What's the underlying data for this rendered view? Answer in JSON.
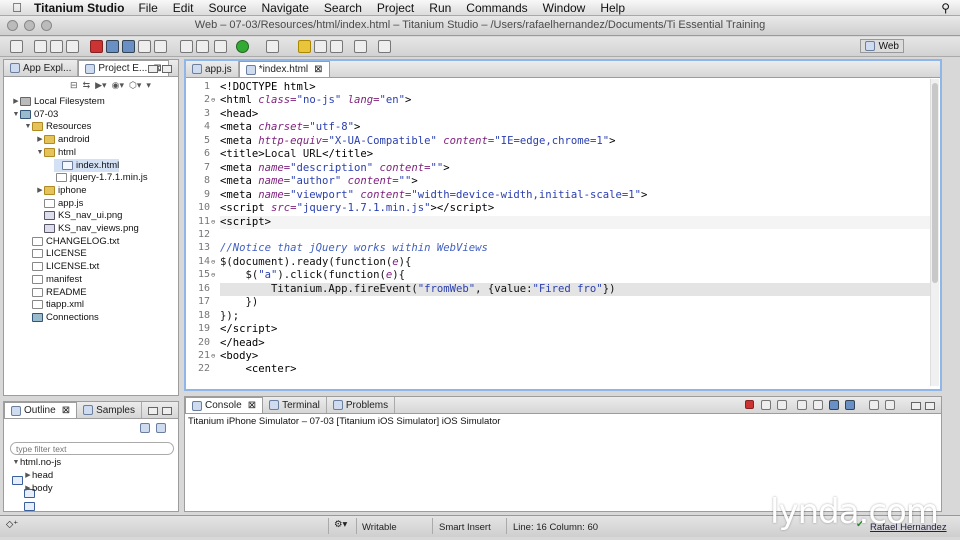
{
  "menubar": {
    "app": "Titanium Studio",
    "items": [
      "File",
      "Edit",
      "Source",
      "Navigate",
      "Search",
      "Project",
      "Run",
      "Commands",
      "Window",
      "Help"
    ]
  },
  "window_title": "Web – 07-03/Resources/html/index.html – Titanium Studio – /Users/rafaelhernandez/Documents/Ti Essential Training",
  "perspective": "Web",
  "explorer": {
    "tabs": [
      {
        "label": "App Expl..."
      },
      {
        "label": "Project E..."
      }
    ],
    "tree": [
      {
        "label": "Local Filesystem",
        "icon": "drive"
      },
      {
        "label": "07-03",
        "icon": "proj"
      },
      {
        "label": "Resources",
        "icon": "folder"
      },
      {
        "label": "android",
        "icon": "folder"
      },
      {
        "label": "html",
        "icon": "folder"
      },
      {
        "label": "index.html",
        "icon": "html"
      },
      {
        "label": "jquery-1.7.1.min.js",
        "icon": "file"
      },
      {
        "label": "iphone",
        "icon": "folder"
      },
      {
        "label": "app.js",
        "icon": "file"
      },
      {
        "label": "KS_nav_ui.png",
        "icon": "img"
      },
      {
        "label": "KS_nav_views.png",
        "icon": "img"
      },
      {
        "label": "CHANGELOG.txt",
        "icon": "file"
      },
      {
        "label": "LICENSE",
        "icon": "file"
      },
      {
        "label": "LICENSE.txt",
        "icon": "file"
      },
      {
        "label": "manifest",
        "icon": "file"
      },
      {
        "label": "README",
        "icon": "file"
      },
      {
        "label": "tiapp.xml",
        "icon": "file"
      },
      {
        "label": "Connections",
        "icon": "proj"
      }
    ]
  },
  "editor": {
    "tabs": [
      {
        "label": "app.js"
      },
      {
        "label": "*index.html"
      }
    ],
    "lines": [
      {
        "n": "1",
        "html": "<span class=\"tg\">&lt;!DOCTYPE html&gt;</span>"
      },
      {
        "n": "2",
        "html": "<span class=\"tg\">&lt;html</span> <span class=\"at\">class=</span><span class=\"st\">\"no-js\"</span> <span class=\"at\">lang=</span><span class=\"st\">\"en\"</span><span class=\"tg\">&gt;</span>"
      },
      {
        "n": "3",
        "html": "<span class=\"tg\">&lt;head&gt;</span>"
      },
      {
        "n": "4",
        "html": "<span class=\"tg\">&lt;meta</span> <span class=\"at\">charset=</span><span class=\"st\">\"utf-8\"</span><span class=\"tg\">&gt;</span>"
      },
      {
        "n": "5",
        "html": "<span class=\"tg\">&lt;meta</span> <span class=\"at\">http-equiv=</span><span class=\"st\">\"X-UA-Compatible\"</span> <span class=\"at\">content=</span><span class=\"st\">\"IE=edge,chrome=1\"</span><span class=\"tg\">&gt;</span>"
      },
      {
        "n": "6",
        "html": "<span class=\"tg\">&lt;title&gt;</span>Local URL<span class=\"tg\">&lt;/title&gt;</span>"
      },
      {
        "n": "7",
        "html": "<span class=\"tg\">&lt;meta</span> <span class=\"at\">name=</span><span class=\"st\">\"description\"</span> <span class=\"at\">content=</span><span class=\"st\">\"\"</span><span class=\"tg\">&gt;</span>"
      },
      {
        "n": "8",
        "html": "<span class=\"tg\">&lt;meta</span> <span class=\"at\">name=</span><span class=\"st\">\"author\"</span> <span class=\"at\">content=</span><span class=\"st\">\"\"</span><span class=\"tg\">&gt;</span>"
      },
      {
        "n": "9",
        "html": "<span class=\"tg\">&lt;meta</span> <span class=\"at\">name=</span><span class=\"st\">\"viewport\"</span> <span class=\"at\">content=</span><span class=\"st\">\"width=device-width,initial-scale=1\"</span><span class=\"tg\">&gt;</span>"
      },
      {
        "n": "10",
        "html": "<span class=\"tg\">&lt;script</span> <span class=\"at\">src=</span><span class=\"st\">\"jquery-1.7.1.min.js\"</span><span class=\"tg\">&gt;&lt;/script&gt;</span>"
      },
      {
        "n": "11",
        "html": "<span class=\"tg\">&lt;script&gt;</span>"
      },
      {
        "n": "12",
        "html": ""
      },
      {
        "n": "13",
        "html": "<span class=\"cm\">//Notice that jQuery works within WebViews</span>"
      },
      {
        "n": "14",
        "html": "$(document).ready(function(<span class=\"vi\">e</span>){"
      },
      {
        "n": "15",
        "html": "    $(<span class=\"st\">\"a\"</span>).click(function(<span class=\"vi\">e</span>){"
      },
      {
        "n": "16",
        "html": "        Titanium.App.fireEvent(<span class=\"st\">\"fromWeb\"</span>, {value:<span class=\"st\">\"Fired fro\"</span>})"
      },
      {
        "n": "17",
        "html": "    })"
      },
      {
        "n": "18",
        "html": "});"
      },
      {
        "n": "19",
        "html": "<span class=\"tg\">&lt;/script&gt;</span>"
      },
      {
        "n": "20",
        "html": "<span class=\"tg\">&lt;/head&gt;</span>"
      },
      {
        "n": "21",
        "html": "<span class=\"tg\">&lt;body&gt;</span>"
      },
      {
        "n": "22",
        "html": "    <span class=\"tg\">&lt;center&gt;</span>"
      }
    ]
  },
  "outline": {
    "tabs": [
      {
        "label": "Outline"
      },
      {
        "label": "Samples"
      }
    ],
    "filter_placeholder": "type filter text",
    "tree": [
      {
        "label": "html.no-js"
      },
      {
        "label": "head"
      },
      {
        "label": "body"
      }
    ]
  },
  "console": {
    "tabs": [
      {
        "label": "Console"
      },
      {
        "label": "Terminal"
      },
      {
        "label": "Problems"
      }
    ],
    "message": "Titanium iPhone Simulator – 07-03 [Titanium iOS Simulator] iOS Simulator"
  },
  "status": {
    "writable": "Writable",
    "insert": "Smart Insert",
    "position": "Line: 16 Column: 60",
    "user": "Rafael Hernandez"
  },
  "watermark": "lynda.com"
}
